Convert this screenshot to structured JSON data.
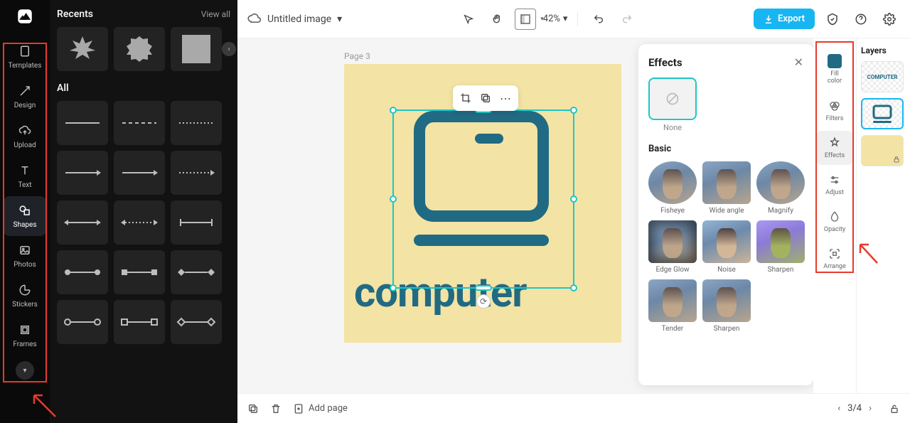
{
  "nav": {
    "templates": "Templates",
    "design": "Design",
    "upload": "Upload",
    "text": "Text",
    "shapes": "Shapes",
    "photos": "Photos",
    "stickers": "Stickers",
    "frames": "Frames"
  },
  "shapesPanel": {
    "recents": "Recents",
    "viewAll": "View all",
    "all": "All"
  },
  "topbar": {
    "docTitle": "Untitled image",
    "zoom": "42%",
    "export": "Export"
  },
  "canvas": {
    "pageLabel": "Page 3",
    "word": "computer"
  },
  "contextbar": {},
  "effects": {
    "title": "Effects",
    "none": "None",
    "basic": "Basic",
    "items": [
      "Fisheye",
      "Wide angle",
      "Magnify",
      "Edge Glow",
      "Noise",
      "Sharpen",
      "Tender",
      "Sharpen"
    ]
  },
  "props": {
    "fillColor": "Fill\ncolor",
    "filters": "Filters",
    "effects": "Effects",
    "adjust": "Adjust",
    "opacity": "Opacity",
    "arrange": "Arrange"
  },
  "layers": {
    "title": "Layers"
  },
  "bottombar": {
    "addPage": "Add page",
    "pageIndicator": "3/4"
  },
  "colors": {
    "accent": "#216a83",
    "artboard": "#f3e3a4",
    "teal": "#1cc7c7",
    "export": "#17b6f3",
    "red": "#e63a2e"
  }
}
